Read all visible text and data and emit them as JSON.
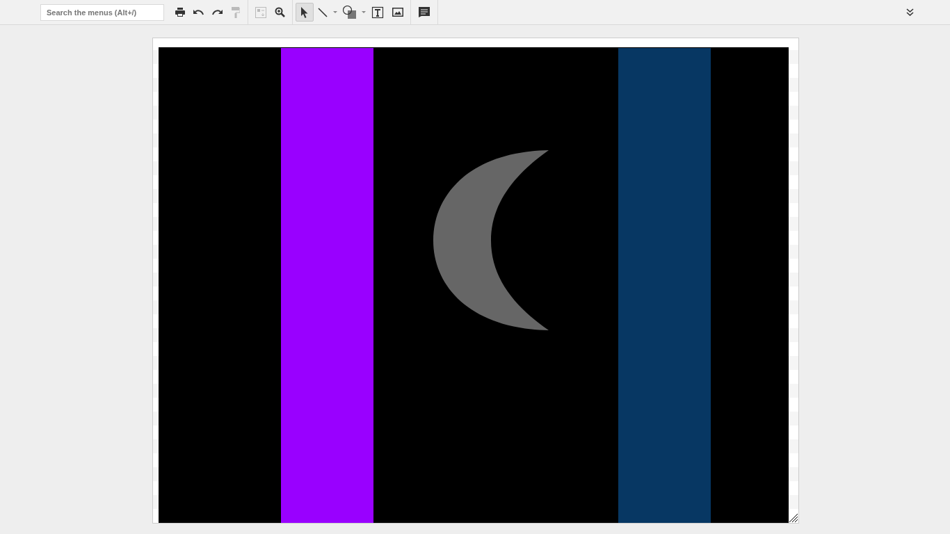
{
  "toolbar": {
    "search": {
      "placeholder": "Search the menus (Alt+/)"
    },
    "groups": [
      [
        {
          "kind": "print",
          "disabled": false,
          "selected": false
        },
        {
          "kind": "undo",
          "disabled": false,
          "selected": false
        },
        {
          "kind": "redo",
          "disabled": false,
          "selected": false
        },
        {
          "kind": "paint-format",
          "disabled": true,
          "selected": false
        }
      ],
      [
        {
          "kind": "fit",
          "disabled": true,
          "selected": false
        },
        {
          "kind": "zoom",
          "disabled": false,
          "selected": false
        }
      ],
      [
        {
          "kind": "select",
          "disabled": false,
          "selected": true
        },
        {
          "kind": "line",
          "disabled": false,
          "selected": false
        },
        {
          "kind": "dropdown",
          "disabled": false,
          "selected": false
        },
        {
          "kind": "shape",
          "disabled": false,
          "selected": false
        },
        {
          "kind": "dropdown",
          "disabled": false,
          "selected": false
        },
        {
          "kind": "textbox",
          "disabled": false,
          "selected": false
        },
        {
          "kind": "image",
          "disabled": false,
          "selected": false
        }
      ],
      [
        {
          "kind": "comment",
          "disabled": false,
          "selected": false
        }
      ]
    ]
  },
  "canvas": {
    "shapes": [
      {
        "kind": "rectangle",
        "color": "#9900ff"
      },
      {
        "kind": "moon",
        "color": "#666666"
      },
      {
        "kind": "rectangle",
        "color": "#073763"
      }
    ]
  }
}
